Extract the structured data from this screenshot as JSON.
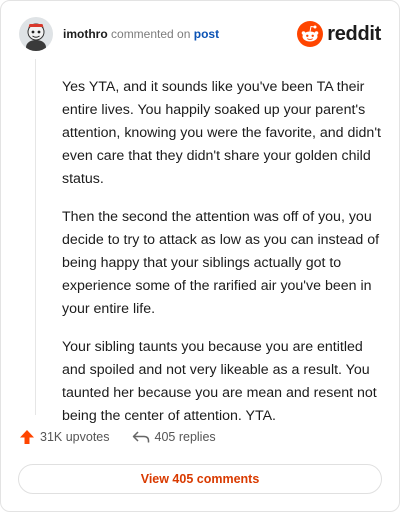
{
  "header": {
    "username": "imothro",
    "commented_text": "commented on",
    "post_link": "post",
    "brand": "reddit"
  },
  "comment": {
    "paragraphs": [
      "Yes YTA, and it sounds like you've been TA their entire lives. You happily soaked up your parent's attention, knowing you were the favorite, and didn't even care that they didn't share your golden child status.",
      "Then the second the attention was off of you, you decide to try to attack as low as you can instead of being happy that your siblings actually got to experience some of the rarified air you've been in your entire life.",
      "Your sibling taunts you because you are entitled and spoiled and not very likeable as a result. You taunted her because you are mean and resent not being the center of attention. YTA."
    ]
  },
  "actions": {
    "upvotes": "31K upvotes",
    "replies": "405 replies"
  },
  "footer": {
    "view_comments": "View 405 comments"
  },
  "colors": {
    "accent_orange": "#ff4500",
    "button_text": "#d93a00",
    "link_blue": "#0a52b4"
  },
  "icons": {
    "avatar": "user-avatar",
    "logo": "reddit-snoo-icon",
    "upvote": "upvote-arrow-icon",
    "reply": "reply-arrow-icon"
  }
}
